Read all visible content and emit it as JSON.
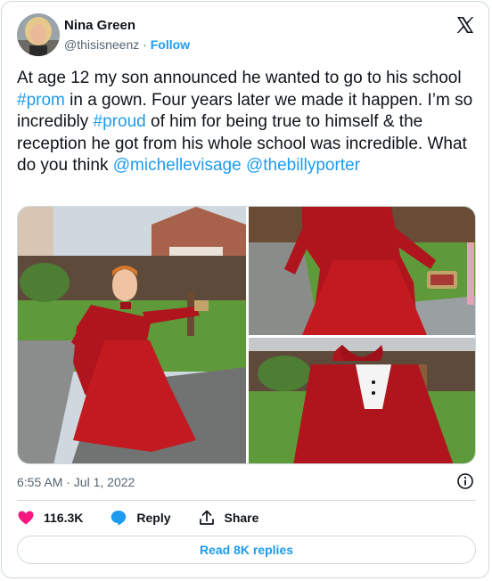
{
  "author": {
    "name": "Nina Green",
    "handle": "@thisisneenz",
    "separator": "·",
    "follow_label": "Follow"
  },
  "tweet": {
    "segments": [
      {
        "text": "At age 12 my son announced he wanted to go to his school ",
        "link": false
      },
      {
        "text": "#prom",
        "link": true
      },
      {
        "text": " in a gown. Four years later we made it happen. I’m so incredibly ",
        "link": false
      },
      {
        "text": "#proud",
        "link": true
      },
      {
        "text": " of him for being true to himself & the reception he got from his whole school was incredible. What do you think ",
        "link": false
      },
      {
        "text": "@michellevisage",
        "link": true
      },
      {
        "text": " ",
        "link": false
      },
      {
        "text": "@thebillyporter",
        "link": true
      }
    ]
  },
  "media": {
    "photo_count": 3
  },
  "timestamp": "6:55 AM · Jul 1, 2022",
  "actions": {
    "like_count": "116.3K",
    "reply_label": "Reply",
    "share_label": "Share"
  },
  "read_replies_label": "Read 8K replies",
  "colors": {
    "accent": "#1d9bf0",
    "heart": "#f91880",
    "text": "#0f1419",
    "muted": "#536471",
    "border": "#cfd9de"
  },
  "icons": [
    "x-logo-icon",
    "heart-icon",
    "reply-bubble-icon",
    "share-icon",
    "info-icon"
  ]
}
